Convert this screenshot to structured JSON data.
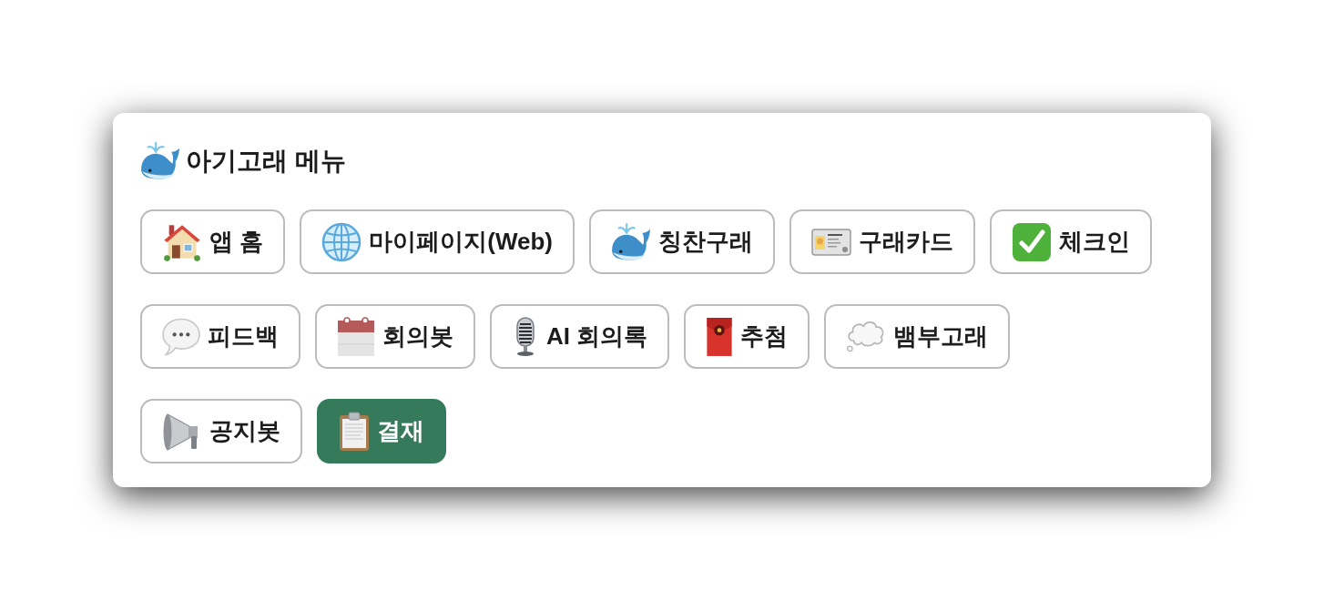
{
  "title": {
    "text": "아기고래 메뉴"
  },
  "rows": [
    {
      "items": [
        {
          "label": "앱 홈",
          "primary": false
        },
        {
          "label": "마이페이지(Web)",
          "primary": false
        },
        {
          "label": "칭찬구래",
          "primary": false
        },
        {
          "label": "구래카드",
          "primary": false
        },
        {
          "label": "체크인",
          "primary": false
        }
      ]
    },
    {
      "items": [
        {
          "label": "피드백",
          "primary": false
        },
        {
          "label": "회의봇",
          "primary": false
        },
        {
          "label": "AI 회의록",
          "primary": false
        },
        {
          "label": "추첨",
          "primary": false
        },
        {
          "label": "뱀부고래",
          "primary": false
        }
      ]
    },
    {
      "items": [
        {
          "label": "공지봇",
          "primary": false
        },
        {
          "label": "결재",
          "primary": true
        }
      ]
    }
  ]
}
